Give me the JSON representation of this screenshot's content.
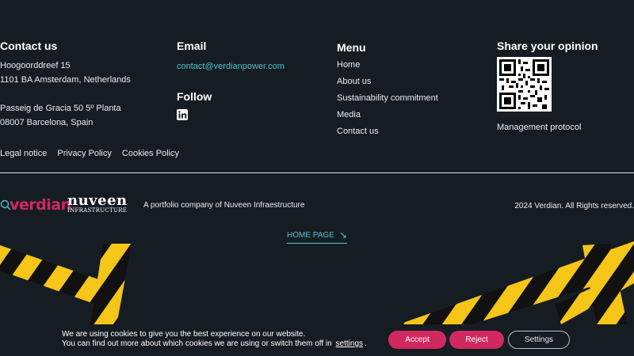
{
  "contact": {
    "title": "Contact us",
    "address1_line1": "Hoogoorddreef 15",
    "address1_line2": "1101 BA Amsterdam, Netherlands",
    "address2_line1": "Passeig de Gracia 50 5º Planta",
    "address2_line2": "08007 Barcelona, Spain"
  },
  "email": {
    "title": "Email",
    "address": "contact@verdianpower.com"
  },
  "follow": {
    "title": "Follow",
    "icon": "linkedin-icon"
  },
  "menu": {
    "title": "Menu",
    "items": [
      "Home",
      "About us",
      "Sustainability commitment",
      "Media",
      "Contact us"
    ]
  },
  "opinion": {
    "title": "Share your opinion",
    "qr_icon": "qr-code-icon",
    "protocol_link": "Management protocol"
  },
  "legal": {
    "items": [
      "Legal notice",
      "Privacy Policy",
      "Cookies Policy"
    ]
  },
  "brand": {
    "verdian_logo": "verdian",
    "nuveen_logo_top": "nuveen",
    "nuveen_logo_bottom": "INFRASTRUCTURE",
    "tagline": "A portfolio company of Nuveen Infraestructure",
    "copyright": "2024 Verdian. All Rights reserved."
  },
  "home_link": {
    "label": "HOME PAGE",
    "icon": "arrow-down-right-icon"
  },
  "cookie_banner": {
    "line1": "We are using cookies to give you the best experience on our website.",
    "line2": "You can find out more about which cookies we are using or switch them off in",
    "settings_link": "settings",
    "period": ".",
    "accept": "Accept",
    "reject": "Reject",
    "settings_button": "Settings"
  },
  "colors": {
    "background": "#161d22",
    "accent": "#4ec0cf",
    "brand_pink": "#d12860",
    "tape_yellow": "#f5c518"
  }
}
